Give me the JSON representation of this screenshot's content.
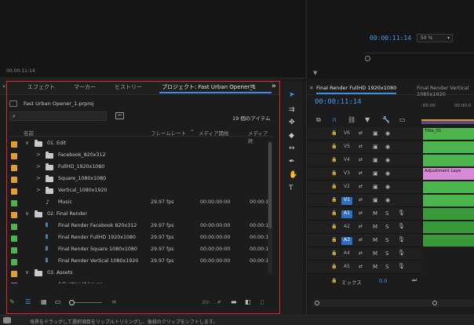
{
  "source_monitor": {
    "timecode": "00:00:11:14"
  },
  "program_monitor": {
    "timecode": "00:00:11:14",
    "zoom": "50 %",
    "marker_icon": "marker-icon"
  },
  "panel_tabs": {
    "prev": "»",
    "effects": "エフェクト",
    "markers": "マーカー",
    "history": "ヒストリー",
    "project": "プロジェクト: Fast Urban Opener_1",
    "project_menu": "≡",
    "overflow": "»"
  },
  "project": {
    "filename": "Fast Urban Opener_1.prproj",
    "search_placeholder": "",
    "item_count": "19 個のアイテム",
    "columns": {
      "name": "名前",
      "fps": "フレームレート",
      "sort": "^",
      "start": "メディア開始",
      "end": "メディア終"
    },
    "rows": [
      {
        "label": "01. Edit",
        "color": "#e0a030",
        "arrow": "∨",
        "type": "folder",
        "depth": 1,
        "fps": "",
        "start": "",
        "end": ""
      },
      {
        "label": "Facebook_820x312",
        "color": "#e0a030",
        "arrow": ">",
        "type": "folder",
        "depth": 2,
        "fps": "",
        "start": "",
        "end": ""
      },
      {
        "label": "FullHD_1920x1080",
        "color": "#e0a030",
        "arrow": ">",
        "type": "folder",
        "depth": 2,
        "fps": "",
        "start": "",
        "end": ""
      },
      {
        "label": "Square_1080x1080",
        "color": "#e0a030",
        "arrow": ">",
        "type": "folder",
        "depth": 2,
        "fps": "",
        "start": "",
        "end": ""
      },
      {
        "label": "Vertical_1080x1920",
        "color": "#e0a030",
        "arrow": ">",
        "type": "folder",
        "depth": 2,
        "fps": "",
        "start": "",
        "end": ""
      },
      {
        "label": "Music",
        "color": "#4db34d",
        "arrow": "",
        "type": "music",
        "depth": 2,
        "fps": "29.97 fps",
        "start": "00:00:00:00",
        "end": "00:00:1"
      },
      {
        "label": "02. Final Render",
        "color": "#e0a030",
        "arrow": "∨",
        "type": "folder",
        "depth": 1,
        "fps": "",
        "start": "",
        "end": ""
      },
      {
        "label": "Final Render Facebook 820x312",
        "color": "#4db34d",
        "arrow": "",
        "type": "sequence",
        "depth": 2,
        "fps": "29.97 fps",
        "start": "00:00:00:00",
        "end": "00:00:1"
      },
      {
        "label": "Final Render FullHD 1920x1080",
        "color": "#4db34d",
        "arrow": "",
        "type": "sequence",
        "depth": 2,
        "fps": "29.97 fps",
        "start": "00:00:00:00",
        "end": "00:00:1"
      },
      {
        "label": "Final Render Square 1080x1080",
        "color": "#4db34d",
        "arrow": "",
        "type": "sequence",
        "depth": 2,
        "fps": "29.97 fps",
        "start": "00:00:00:00",
        "end": "00:00:1"
      },
      {
        "label": "Final Render Vertical 1080x1920",
        "color": "#4db34d",
        "arrow": "",
        "type": "sequence",
        "depth": 2,
        "fps": "29.97 fps",
        "start": "00:00:00:00",
        "end": "00:00:1"
      },
      {
        "label": "03. Assets",
        "color": "#e0a030",
        "arrow": "∨",
        "type": "folder",
        "depth": 1,
        "fps": "",
        "start": "",
        "end": ""
      },
      {
        "label": "Adjustment Layer",
        "color": "#d05ad0",
        "arrow": "",
        "type": "item",
        "depth": 2,
        "fps": "",
        "start": "",
        "end": ""
      }
    ]
  },
  "project_toolbar": {
    "automate_label": "Bin"
  },
  "timeline": {
    "tab_active": "Final Render FullHD 1920x1080",
    "tab_other": "Final Render Vertical 1080x1920",
    "close": "×",
    "timecode": "00:00:11:14",
    "ruler": [
      ":00:00",
      "00:00:0"
    ],
    "tracks": [
      {
        "name": "V6",
        "active": false,
        "clip": "Title_01",
        "clip_color": "#4db34d"
      },
      {
        "name": "V5",
        "active": false,
        "clip": "",
        "clip_color": "#4db34d"
      },
      {
        "name": "V4",
        "active": false,
        "clip": "",
        "clip_color": "#4db34d"
      },
      {
        "name": "V3",
        "active": false,
        "clip": "Adjustment Laye",
        "clip_color": "#d88ad8"
      },
      {
        "name": "V2",
        "active": false,
        "clip": "",
        "clip_color": "#4db34d"
      },
      {
        "name": "V1",
        "active": true,
        "clip": "",
        "clip_color": "#4db34d"
      },
      {
        "name": "A1",
        "active": true,
        "clip": "",
        "clip_color": "#3a9a3a"
      },
      {
        "name": "A2",
        "active": false,
        "clip": "",
        "clip_color": "#3a9a3a"
      },
      {
        "name": "A3",
        "active": true,
        "clip": "",
        "clip_color": "#3a9a3a"
      },
      {
        "name": "A4",
        "active": false,
        "clip": "",
        "clip_color": ""
      },
      {
        "name": "A5",
        "active": false,
        "clip": "",
        "clip_color": ""
      }
    ],
    "mix_label": "ミックス",
    "mix_value": "0.0"
  },
  "status_bar": {
    "text": "境界をドラッグして選択項目をリップルトリミングし、後続のクリップをシフトします。"
  },
  "colors": {
    "accent": "#3a9bf3",
    "highlight": "#e0282e",
    "folder_label": "#e0a030",
    "sequence_label": "#4db34d",
    "adjustment_label": "#d05ad0"
  }
}
